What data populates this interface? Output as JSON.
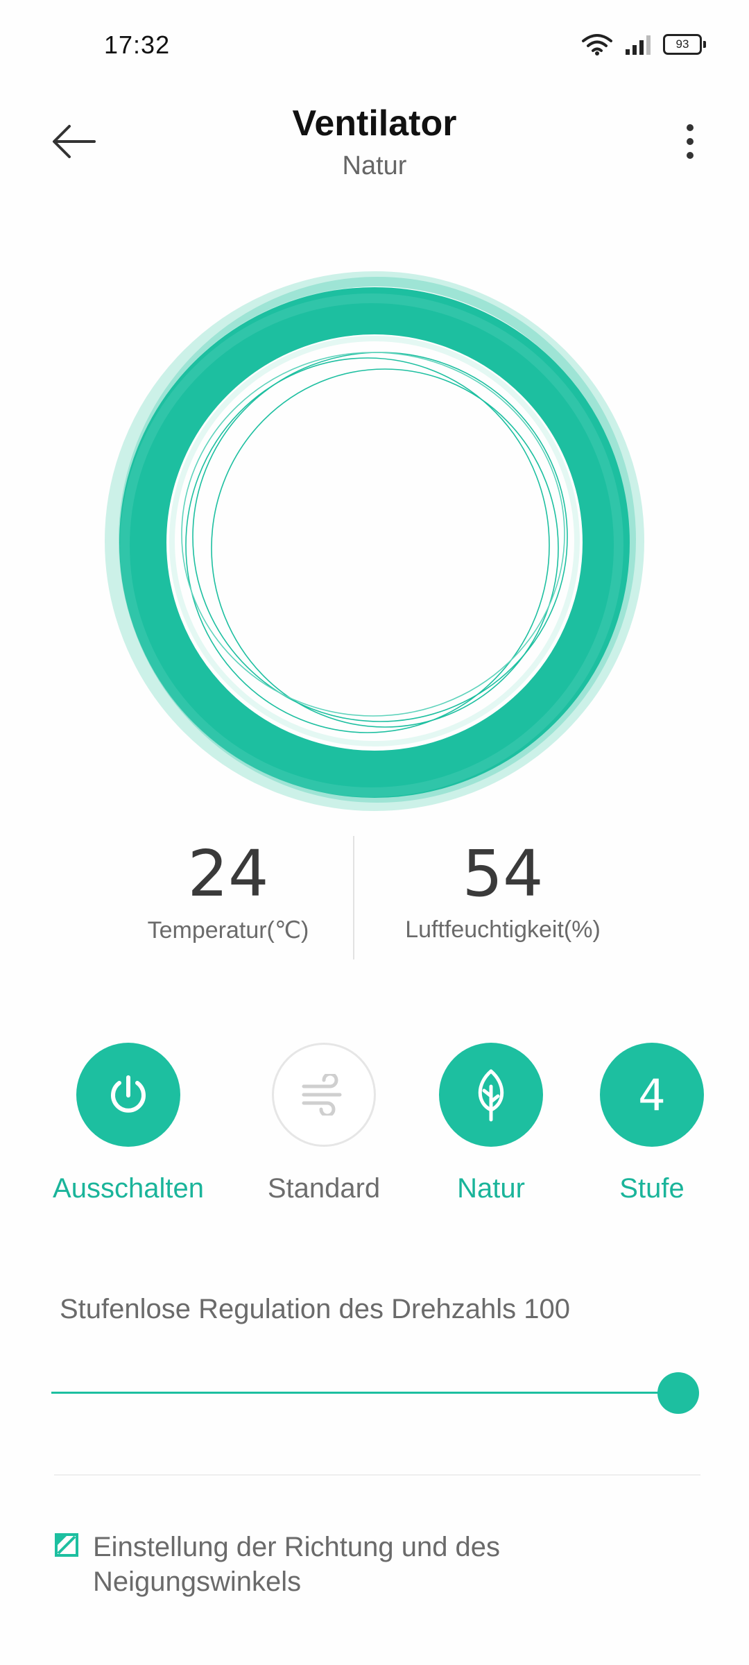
{
  "status_bar": {
    "time": "17:32",
    "battery": "93",
    "icons": [
      "wifi-icon",
      "cellular-signal-icon",
      "battery-icon"
    ]
  },
  "header": {
    "title": "Ventilator",
    "subtitle": "Natur",
    "back_icon": "arrow-left-icon",
    "menu_icon": "more-vertical-icon"
  },
  "fan_visual": {
    "icon": "fan-ring-animation"
  },
  "readings": {
    "temperature": {
      "value": "24",
      "label": "Temperatur(℃)"
    },
    "humidity": {
      "value": "54",
      "label": "Luftfeuchtigkeit(%)"
    }
  },
  "modes": [
    {
      "label": "Ausschalten",
      "icon": "power-icon",
      "active": true
    },
    {
      "label": "Standard",
      "icon": "wind-icon",
      "active": false
    },
    {
      "label": "Natur",
      "icon": "leaf-icon",
      "active": true
    },
    {
      "label": "Stufe",
      "value": "4",
      "active": true
    }
  ],
  "speed_slider": {
    "label": "Stufenlose Regulation des Drehzahls 100",
    "value": 100,
    "max": 100
  },
  "direction_setting": {
    "label": "Einstellung der Richtung und des Neigungswinkels",
    "icon": "direction-angle-icon"
  },
  "colors": {
    "accent": "#1dbfa0",
    "accent_light": "#9fe6d8",
    "text_muted": "#6a6a6a",
    "inactive_border": "#e6e6e6"
  }
}
